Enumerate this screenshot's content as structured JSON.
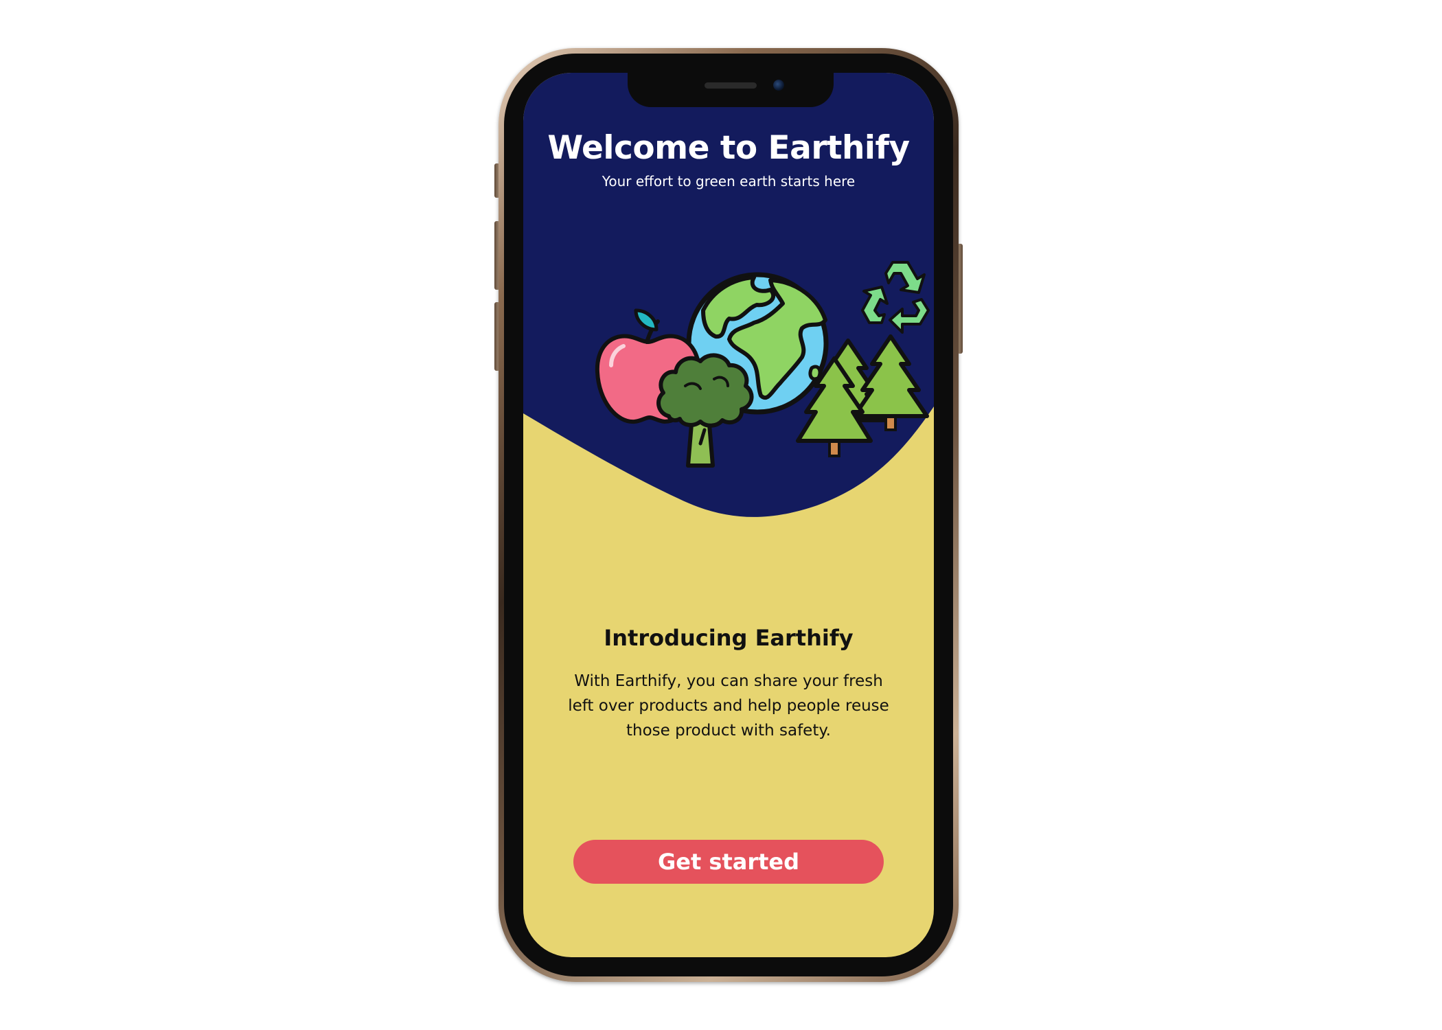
{
  "onboarding": {
    "title": "Welcome to Earthify",
    "subtitle": "Your effort to green earth starts here",
    "intro_heading": "Introducing Earthify",
    "intro_body": "With Earthify, you can share your fresh left over products and help people reuse those product with safety.",
    "cta_label": "Get started"
  },
  "illustration": {
    "icons": [
      "apple-icon",
      "broccoli-icon",
      "globe-icon",
      "pine-trees-icon",
      "recycle-icon"
    ]
  },
  "colors": {
    "hero_background": "#131b5d",
    "body_background": "#e7d571",
    "cta_background": "#e5525c",
    "cta_text": "#ffffff",
    "phone_frame": "#b89a7e"
  }
}
